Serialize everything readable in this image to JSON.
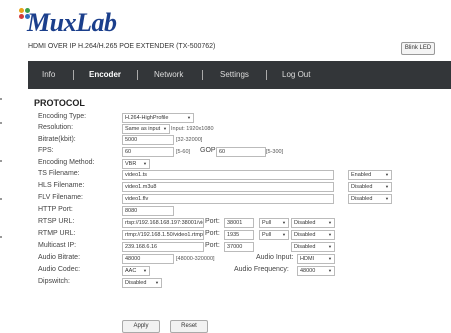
{
  "brand": {
    "name": "MuxLab",
    "subtitle": "HDMI OVER IP H.264/H.265 POE EXTENDER (TX-500762)"
  },
  "blink_led": "Blink LED",
  "nav": [
    "Info",
    "Encoder",
    "Network",
    "Settings",
    "Log Out"
  ],
  "section_title": "PROTOCOL",
  "fields": {
    "encoding_type": {
      "label": "Encoding Type:",
      "value": "H.264-HighProfile"
    },
    "resolution": {
      "label": "Resolution:",
      "value": "Same as input",
      "note": "Input: 1920x1080"
    },
    "bitrate": {
      "label": "Bitrate(kbit):",
      "value": "5000",
      "range": "[32-32000]"
    },
    "fps": {
      "label": "FPS:",
      "value": "60",
      "range": "[5-60]",
      "gop_label": "GOP:",
      "gop_value": "60",
      "gop_range": "[5-300]"
    },
    "encoding_method": {
      "label": "Encoding Method:",
      "value": "VBR"
    },
    "ts": {
      "label": "TS Filename:",
      "value": "video1.ts",
      "status": "Enabled"
    },
    "hls": {
      "label": "HLS Filename:",
      "value": "video1.m3u8",
      "status": "Disabled"
    },
    "flv": {
      "label": "FLV Filename:",
      "value": "video1.flv",
      "status": "Disabled"
    },
    "http_port": {
      "label": "HTTP Port:",
      "value": "8080"
    },
    "rtsp": {
      "label": "RTSP URL:",
      "value": "rtsp://192.168.168.197:38001/vide",
      "port_label": "Port:",
      "port": "38001",
      "mode": "Pull",
      "status": "Disabled"
    },
    "rtmp": {
      "label": "RTMP URL:",
      "value": "rtmp://192.168.1.50/video1.rtmp",
      "port_label": "Port:",
      "port": "1935",
      "mode": "Pull",
      "status": "Disabled"
    },
    "multicast": {
      "label": "Multicast IP:",
      "value": "239.168.6.16",
      "port_label": "Port:",
      "port": "37000",
      "status": "Disabled"
    },
    "audio_bitrate": {
      "label": "Audio Bitrate:",
      "value": "48000",
      "range": "[48000-320000]",
      "input_label": "Audio Input:",
      "input_value": "HDMI"
    },
    "audio_codec": {
      "label": "Audio Codec:",
      "value": "AAC",
      "freq_label": "Audio Frequency:",
      "freq_value": "48000"
    },
    "dipswitch": {
      "label": "Dipswitch:",
      "value": "Disabled"
    }
  },
  "buttons": {
    "apply": "Apply",
    "reset": "Reset"
  },
  "colors": {
    "nav_bg": "#333639",
    "brand_blue": "#1b3f8c"
  }
}
